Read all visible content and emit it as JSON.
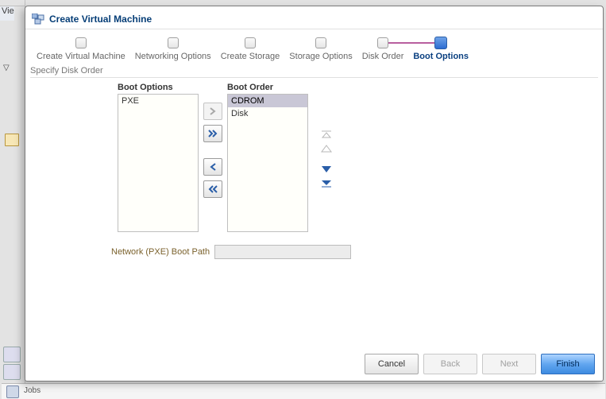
{
  "background": {
    "view_fragment": "Vie",
    "tree_toggle": "▽",
    "jobs_label": "Jobs"
  },
  "wizard": {
    "title": "Create Virtual Machine",
    "steps": [
      {
        "label": "Create Virtual Machine",
        "state": "done"
      },
      {
        "label": "Networking Options",
        "state": "done"
      },
      {
        "label": "Create Storage",
        "state": "done"
      },
      {
        "label": "Storage Options",
        "state": "done"
      },
      {
        "label": "Disk Order",
        "state": "done"
      },
      {
        "label": "Boot Options",
        "state": "current"
      }
    ],
    "section_heading": "Specify Disk Order",
    "boot_options": {
      "label": "Boot Options",
      "items": [
        "PXE"
      ],
      "move_right_disabled": true
    },
    "boot_order": {
      "label": "Boot Order",
      "items": [
        "CDROM",
        "Disk"
      ],
      "selected": "CDROM"
    },
    "reorder": {
      "top_disabled": true,
      "up_disabled": true,
      "down_disabled": false,
      "bottom_disabled": false
    },
    "pxe": {
      "label": "Network (PXE) Boot Path",
      "value": ""
    },
    "buttons": {
      "cancel": "Cancel",
      "back": "Back",
      "next": "Next",
      "finish": "Finish",
      "back_disabled": true,
      "next_disabled": true
    }
  }
}
